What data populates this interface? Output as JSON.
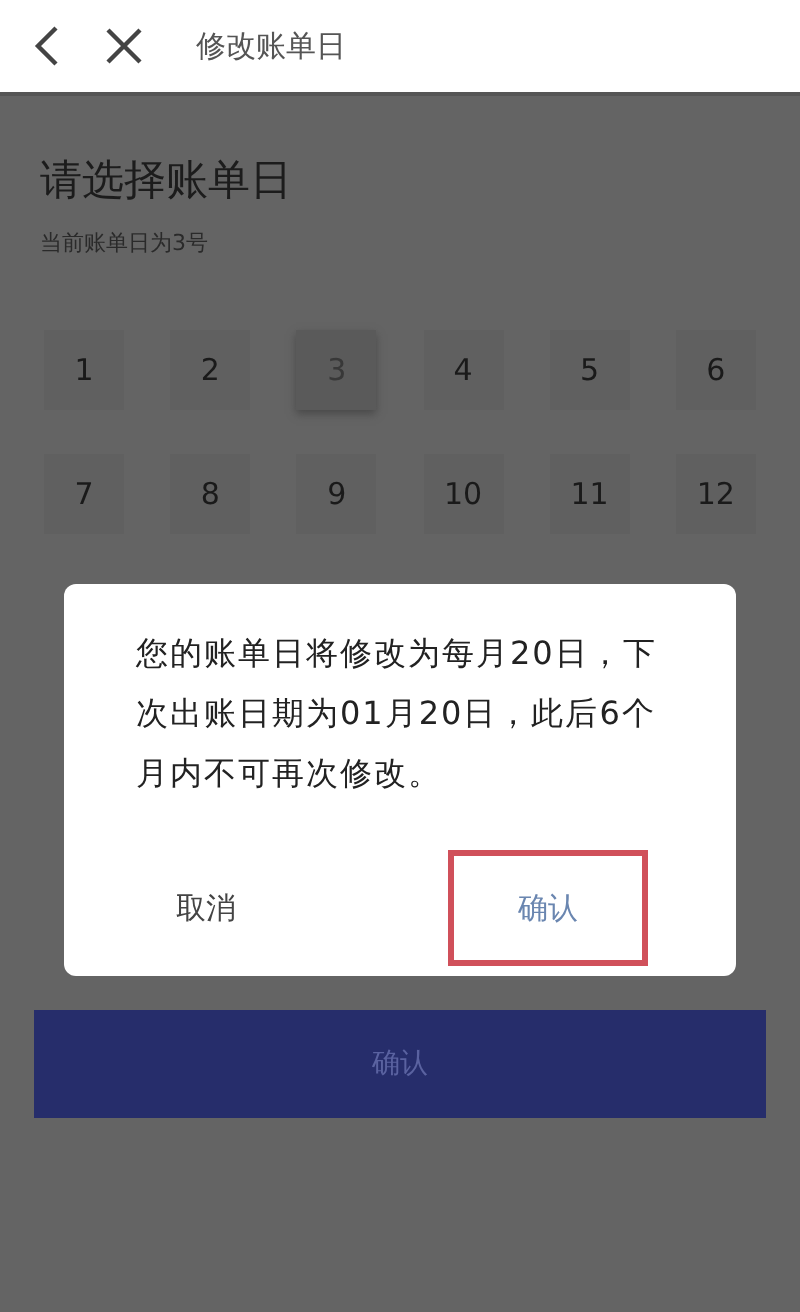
{
  "header": {
    "title": "修改账单日"
  },
  "page": {
    "heading": "请选择账单日",
    "subtitle": "当前账单日为3号",
    "days": [
      {
        "label": "1",
        "selected": false
      },
      {
        "label": "2",
        "selected": false
      },
      {
        "label": "3",
        "selected": true
      },
      {
        "label": "4",
        "selected": false
      },
      {
        "label": "5",
        "selected": false
      },
      {
        "label": "6",
        "selected": false
      },
      {
        "label": "7",
        "selected": false
      },
      {
        "label": "8",
        "selected": false
      },
      {
        "label": "9",
        "selected": false
      },
      {
        "label": "10",
        "selected": false
      },
      {
        "label": "11",
        "selected": false
      },
      {
        "label": "12",
        "selected": false
      }
    ],
    "confirm_button": "确认"
  },
  "dialog": {
    "message": "您的账单日将修改为每月20日，下次出账日期为01月20日，此后6个月内不可再次修改。",
    "buttons": [
      {
        "label": "取消",
        "highlighted": false
      },
      {
        "label": "确认",
        "highlighted": true
      }
    ]
  }
}
